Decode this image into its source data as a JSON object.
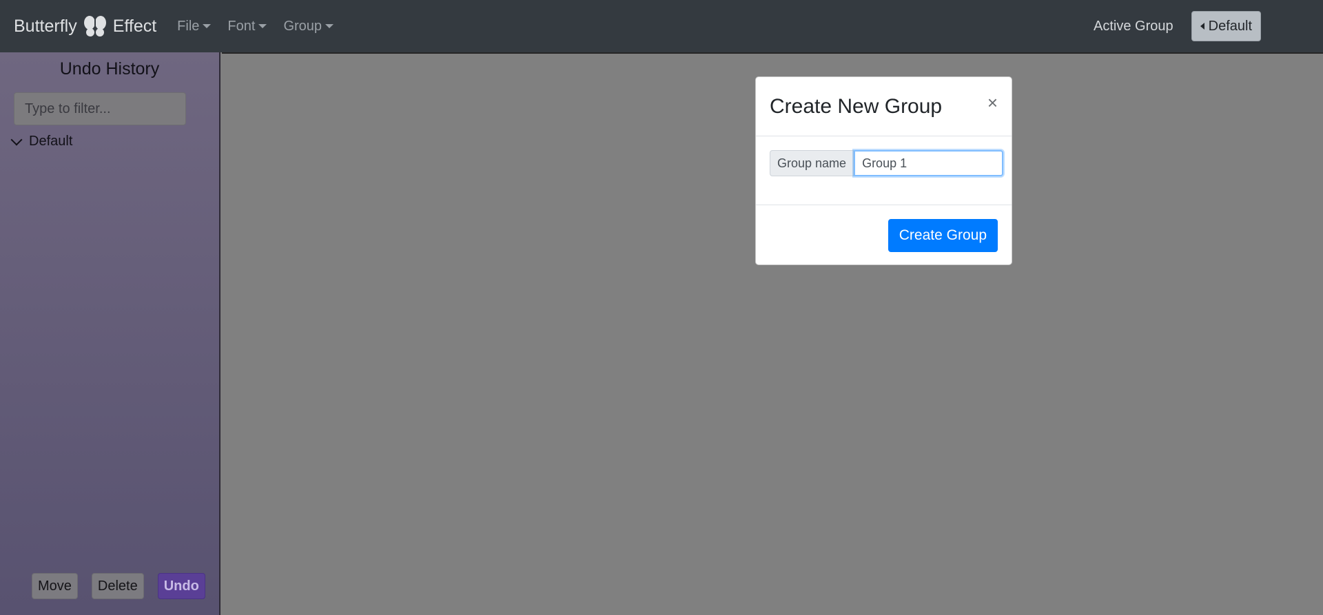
{
  "navbar": {
    "brand_left": "Butterfly",
    "brand_right": "Effect",
    "brand_icon": "butterfly-icon",
    "menus": [
      "File",
      "Font",
      "Group"
    ],
    "active_group_label": "Active Group",
    "active_group_value": "Default"
  },
  "sidebar": {
    "title": "Undo History",
    "filter_placeholder": "Type to filter...",
    "tree": [
      {
        "label": "Default",
        "expanded": true
      }
    ],
    "actions": {
      "move": "Move",
      "delete": "Delete",
      "undo": "Undo"
    }
  },
  "modal": {
    "title": "Create New Group",
    "close": "×",
    "field_label": "Group name",
    "field_value": "Group 1",
    "submit": "Create Group"
  },
  "colors": {
    "navbar_bg": "#343a40",
    "primary": "#007bff",
    "undo_accent": "#5a3f96"
  }
}
